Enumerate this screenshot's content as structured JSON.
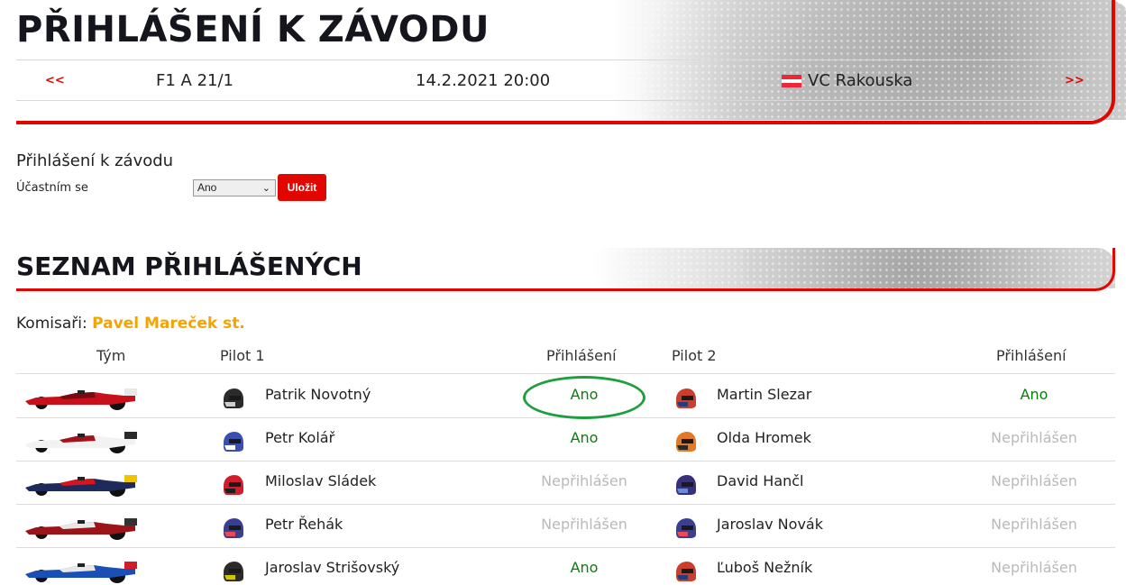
{
  "header": {
    "title": "PŘIHLÁŠENÍ K ZÁVODU",
    "prev_label": "<<",
    "next_label": ">>",
    "race_code": "F1 A 21/1",
    "race_datetime": "14.2.2021 20:00",
    "race_name": "VC Rakouska",
    "flag_icon": "austria-flag-icon"
  },
  "form": {
    "title": "Přihlášení k závodu",
    "participate_label": "Účastním se",
    "participate_value": "Ano",
    "save_label": "Uložit"
  },
  "list": {
    "title": "SEZNAM PŘIHLÁŠENÝCH",
    "stewards_label": "Komisaři:",
    "stewards_name": "Pavel Mareček st."
  },
  "table": {
    "headers": [
      "Tým",
      "Pilot 1",
      "Přihlášení",
      "Pilot 2",
      "Přihlášení"
    ],
    "rows": [
      {
        "team_car": "ferrari-car-icon",
        "pilot1": "Patrik Novotný",
        "status1": "Ano",
        "pilot2": "Martin Slezar",
        "status2": "Ano"
      },
      {
        "team_car": "alfa-romeo-car-icon",
        "pilot1": "Petr Kolář",
        "status1": "Ano",
        "pilot2": "Olda Hromek",
        "status2": "Nepřihlášen"
      },
      {
        "team_car": "red-bull-car-icon",
        "pilot1": "Miloslav Sládek",
        "status1": "Nepřihlášen",
        "pilot2": "David Hančl",
        "status2": "Nepřihlášen"
      },
      {
        "team_car": "haas-car-icon",
        "pilot1": "Petr Řehák",
        "status1": "Nepřihlášen",
        "pilot2": "Jaroslav Novák",
        "status2": "Nepřihlášen"
      },
      {
        "team_car": "alpine-car-icon",
        "pilot1": "Jaroslav Strišovský",
        "status1": "Ano",
        "pilot2": "Ľuboš Nežník",
        "status2": "Nepřihlášen"
      }
    ]
  },
  "colors": {
    "accent": "#e10600",
    "registered": "#0a7d0a",
    "unregistered": "#b9b9b9",
    "steward": "#f5a300",
    "highlight_circle": "#1e9e3c"
  }
}
